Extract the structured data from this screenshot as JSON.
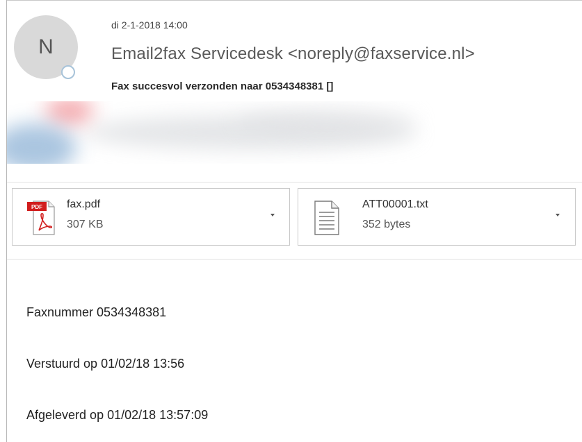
{
  "header": {
    "avatar_initial": "N",
    "date": "di 2-1-2018 14:00",
    "sender": "Email2fax Servicedesk <noreply@faxservice.nl>",
    "subject": "Fax succesvol verzonden naar 0534348381 []"
  },
  "attachments": [
    {
      "name": "fax.pdf",
      "size": "307 KB",
      "icon": "pdf-file-icon",
      "badge": "PDF"
    },
    {
      "name": "ATT00001.txt",
      "size": "352 bytes",
      "icon": "text-file-icon"
    }
  ],
  "body": {
    "lines": [
      "Faxnummer 0534348381",
      "Verstuurd op 01/02/18 13:56",
      "Afgeleverd op 01/02/18 13:57:09"
    ]
  },
  "colors": {
    "pdf_red": "#d11d1d",
    "avatar_bg": "#d9d9d9",
    "presence_ring": "#a7c3d9"
  }
}
